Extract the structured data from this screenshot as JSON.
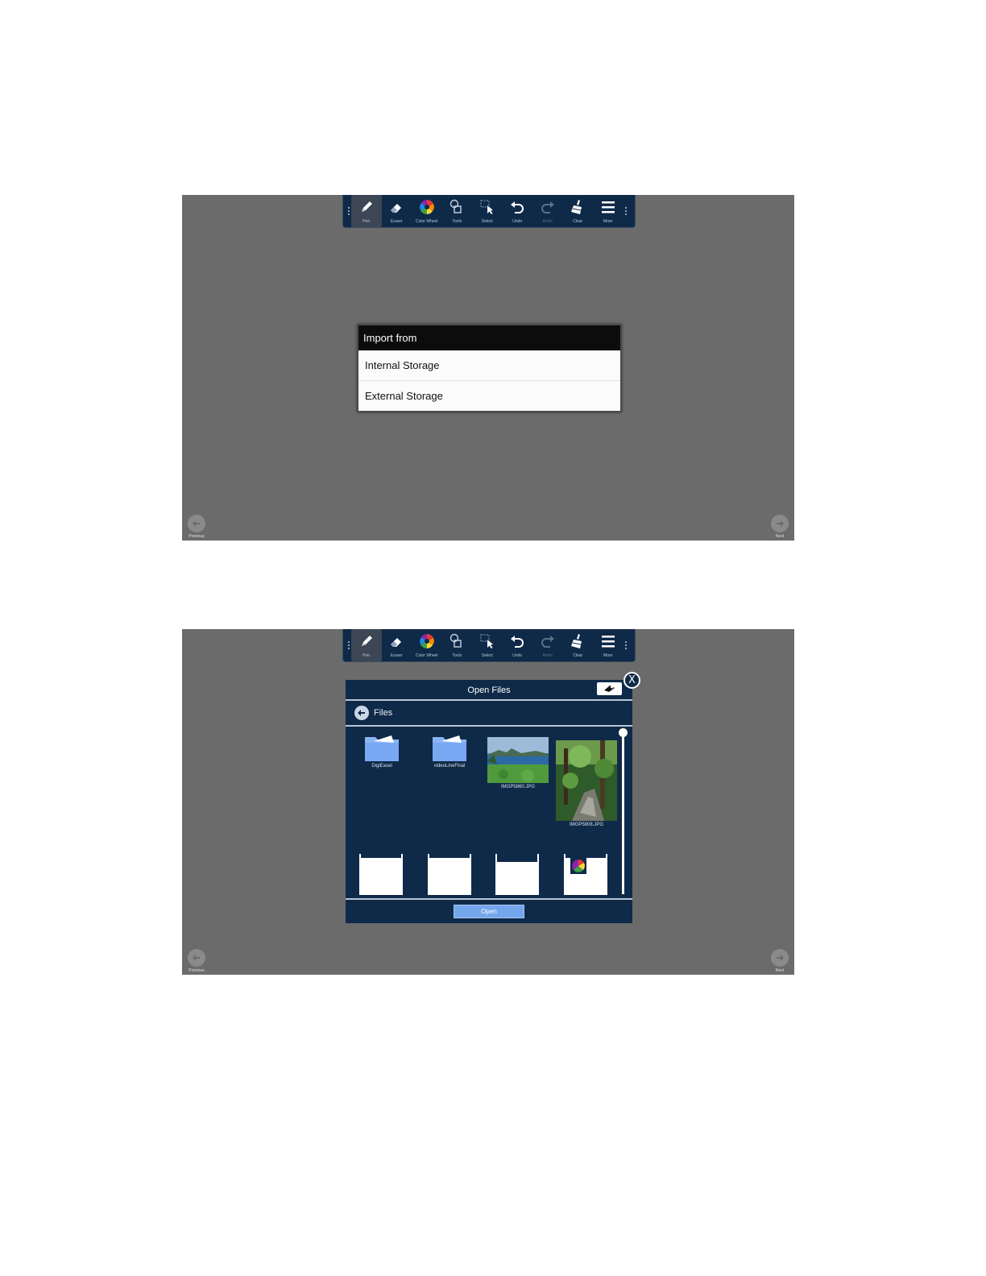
{
  "toolbar": {
    "items": [
      {
        "label": "Pen",
        "icon": "pen-icon"
      },
      {
        "label": "Eraser",
        "icon": "eraser-icon"
      },
      {
        "label": "Color Wheel",
        "icon": "color-wheel-icon"
      },
      {
        "label": "Tools",
        "icon": "tools-icon"
      },
      {
        "label": "Select",
        "icon": "select-icon"
      },
      {
        "label": "Undo",
        "icon": "undo-icon"
      },
      {
        "label": "Redo",
        "icon": "redo-icon"
      },
      {
        "label": "Clear",
        "icon": "clear-icon"
      },
      {
        "label": "More",
        "icon": "menu-icon"
      }
    ]
  },
  "nav": {
    "previous": "Previous",
    "next": "Next"
  },
  "import_dialog": {
    "title": "Import from",
    "options": [
      "Internal Storage",
      "External Storage"
    ]
  },
  "open_dialog": {
    "title": "Open Files",
    "path": "Files",
    "files": [
      {
        "name": "DigiEasel",
        "type": "folder"
      },
      {
        "name": "videoLineFinal",
        "type": "folder"
      },
      {
        "name": "IMGP5860.JPG",
        "type": "image"
      },
      {
        "name": "IMGP5808.JPG",
        "type": "image"
      }
    ],
    "open_button": "Open",
    "close_label": "X"
  },
  "colors": {
    "canvas": "#6b6b6b",
    "toolbar": "#0f2a48",
    "accent": "#74a6ec"
  }
}
